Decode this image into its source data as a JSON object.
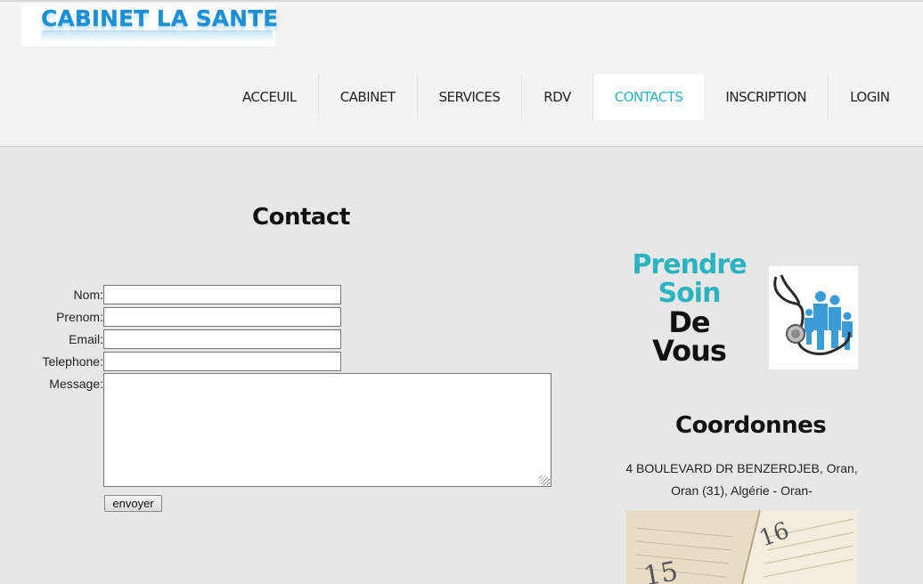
{
  "header": {
    "logo_text": "CABINET LA SANTE",
    "nav": [
      {
        "label": "ACCEUIL",
        "active": false
      },
      {
        "label": "CABINET",
        "active": false
      },
      {
        "label": "SERVICES",
        "active": false
      },
      {
        "label": "RDV",
        "active": false
      },
      {
        "label": "CONTACTS",
        "active": true
      },
      {
        "label": "INSCRIPTION",
        "active": false
      },
      {
        "label": "LOGIN",
        "active": false
      }
    ]
  },
  "contact_form": {
    "title": "Contact",
    "fields": {
      "nom_label": "Nom:",
      "prenom_label": "Prenom:",
      "email_label": "Email:",
      "telephone_label": "Telephone:",
      "message_label": "Message:"
    },
    "values": {
      "nom": "",
      "prenom": "",
      "email": "",
      "telephone": "",
      "message": ""
    },
    "submit_label": "envoyer"
  },
  "sidebar": {
    "tagline": {
      "line1": "Prendre",
      "line2": "Soin",
      "line3": "De",
      "line4": "Vous"
    },
    "coords_title": "Coordonnes",
    "address_line1": "4 BOULEVARD DR BENZERDJEB, Oran,",
    "address_line2": "Oran (31), Algérie - Oran-",
    "calendar_numbers": {
      "a": "16",
      "b": "15"
    }
  },
  "colors": {
    "accent": "#2bb3c0",
    "logo_blue": "#1e8fd4",
    "page_bg": "#e7e7e7"
  },
  "icons": [
    "stethoscope-family-image",
    "calendar-planner-image"
  ]
}
